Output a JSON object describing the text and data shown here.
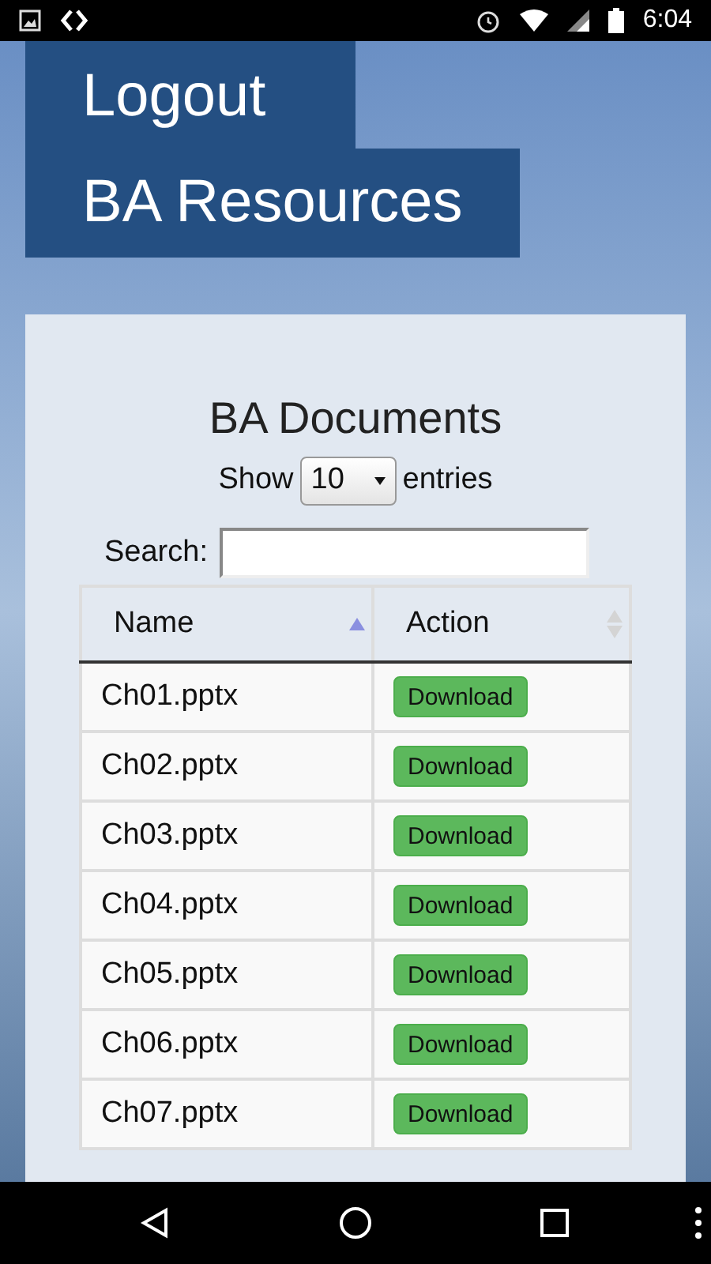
{
  "status_bar": {
    "time": "6:04"
  },
  "nav": [
    {
      "label": "Logout"
    },
    {
      "label": "BA Resources"
    }
  ],
  "card": {
    "title": "BA Documents",
    "length": {
      "before": "Show",
      "value": "10",
      "after": "entries"
    },
    "search": {
      "label": "Search:"
    }
  },
  "table": {
    "columns": [
      {
        "label": "Name",
        "sorted": true
      },
      {
        "label": "Action",
        "sorted": false
      }
    ],
    "rows": [
      {
        "name": "Ch01.pptx",
        "action": "Download"
      },
      {
        "name": "Ch02.pptx",
        "action": "Download"
      },
      {
        "name": "Ch03.pptx",
        "action": "Download"
      },
      {
        "name": "Ch04.pptx",
        "action": "Download"
      },
      {
        "name": "Ch05.pptx",
        "action": "Download"
      },
      {
        "name": "Ch06.pptx",
        "action": "Download"
      },
      {
        "name": "Ch07.pptx",
        "action": "Download"
      }
    ]
  }
}
